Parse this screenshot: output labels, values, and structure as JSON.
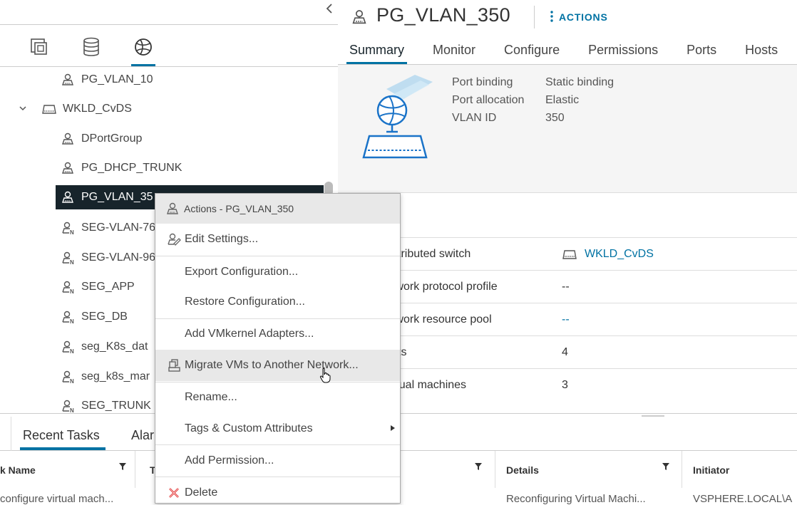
{
  "navigator": {
    "collapse_icon": "chevron-left-icon",
    "view_icons": [
      "hosts-clusters-icon",
      "storage-icon",
      "networking-icon"
    ],
    "tree": [
      {
        "label": "PG_VLAN_10",
        "icon": "portgroup-icon"
      },
      {
        "label": "WKLD_CvDS",
        "icon": "switch-icon",
        "expanded": true
      },
      {
        "label": "DPortGroup",
        "icon": "portgroup-icon"
      },
      {
        "label": "PG_DHCP_TRUNK",
        "icon": "portgroup-icon"
      },
      {
        "label": "PG_VLAN_35",
        "icon": "portgroup-icon",
        "selected": true
      },
      {
        "label": "SEG-VLAN-76",
        "icon": "nsx-segment-icon"
      },
      {
        "label": "SEG-VLAN-96",
        "icon": "nsx-segment-icon"
      },
      {
        "label": "SEG_APP",
        "icon": "nsx-segment-icon"
      },
      {
        "label": "SEG_DB",
        "icon": "nsx-segment-icon"
      },
      {
        "label": "seg_K8s_dat",
        "icon": "nsx-segment-icon"
      },
      {
        "label": "seg_k8s_mar",
        "icon": "nsx-segment-icon"
      },
      {
        "label": "SEG_TRUNK",
        "icon": "nsx-segment-icon"
      }
    ]
  },
  "header": {
    "title": "PG_VLAN_350",
    "actions_label": "ACTIONS"
  },
  "tabs": [
    "Summary",
    "Monitor",
    "Configure",
    "Permissions",
    "Ports",
    "Hosts"
  ],
  "summary": {
    "properties": [
      {
        "key": "Port binding",
        "value": "Static binding"
      },
      {
        "key": "Port allocation",
        "value": "Elastic"
      },
      {
        "key": "VLAN ID",
        "value": "350"
      }
    ],
    "details": [
      {
        "key": "stributed switch",
        "value": "WKLD_CvDS",
        "link": true
      },
      {
        "key": "twork protocol profile",
        "value": "--",
        "link": false
      },
      {
        "key": "twork resource pool",
        "value": "--",
        "link": true
      },
      {
        "key": "sts",
        "value": "4",
        "link": false
      },
      {
        "key": "rtual machines",
        "value": "3",
        "link": false
      }
    ]
  },
  "context_menu": {
    "header": "Actions - PG_VLAN_350",
    "items": [
      {
        "label": "Edit Settings...",
        "icon": "edit-settings-icon"
      },
      {
        "label": "Export Configuration..."
      },
      {
        "label": "Restore Configuration..."
      },
      {
        "label": "Add VMkernel Adapters..."
      },
      {
        "label": "Migrate VMs to Another Network...",
        "icon": "migrate-icon",
        "hovered": true
      },
      {
        "label": "Rename..."
      },
      {
        "label": "Tags & Custom Attributes",
        "submenu": true
      },
      {
        "label": "Add Permission..."
      },
      {
        "label": "Delete",
        "icon": "delete-icon"
      }
    ]
  },
  "bottom_panel": {
    "tabs": [
      "Recent Tasks",
      "Alar"
    ],
    "columns": [
      "k Name",
      "T",
      "Details",
      "Initiator"
    ],
    "row": {
      "name": "configure virtual mach...",
      "details": "Reconfiguring Virtual Machi...",
      "initiator": "VSPHERE.LOCAL\\A"
    }
  },
  "colors": {
    "accent": "#0072a3",
    "selected_bg": "#17242b",
    "delete_red": "#e02020"
  }
}
